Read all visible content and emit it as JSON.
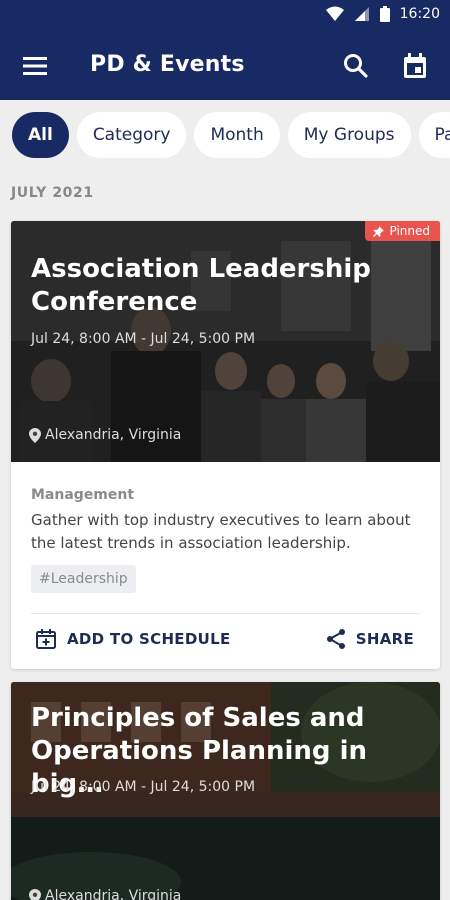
{
  "status": {
    "time": "16:20"
  },
  "appbar": {
    "title": "PD & Events"
  },
  "filters": [
    "All",
    "Category",
    "Month",
    "My Groups",
    "Pa"
  ],
  "month_header": "JULY 2021",
  "events": [
    {
      "title": "Association Leadership Conference",
      "dates": "Jul 24, 8:00 AM - Jul 24, 5:00 PM",
      "location": "Alexandria, Virginia",
      "badge": "Pinned",
      "category": "Management",
      "description": "Gather with top industry executives to learn about the latest trends in association leadership.",
      "tag": "#Leadership",
      "add_label": "ADD TO SCHEDULE",
      "share_label": "SHARE"
    },
    {
      "title": "Principles of Sales and Operations Planning in big…",
      "dates": "Jul 24, 8:00 AM - Jul 24, 5:00 PM",
      "location": "Alexandria, Virginia"
    }
  ],
  "colors": {
    "primary": "#172a63",
    "pinned": "#e8544e",
    "background": "#eeeeee"
  }
}
